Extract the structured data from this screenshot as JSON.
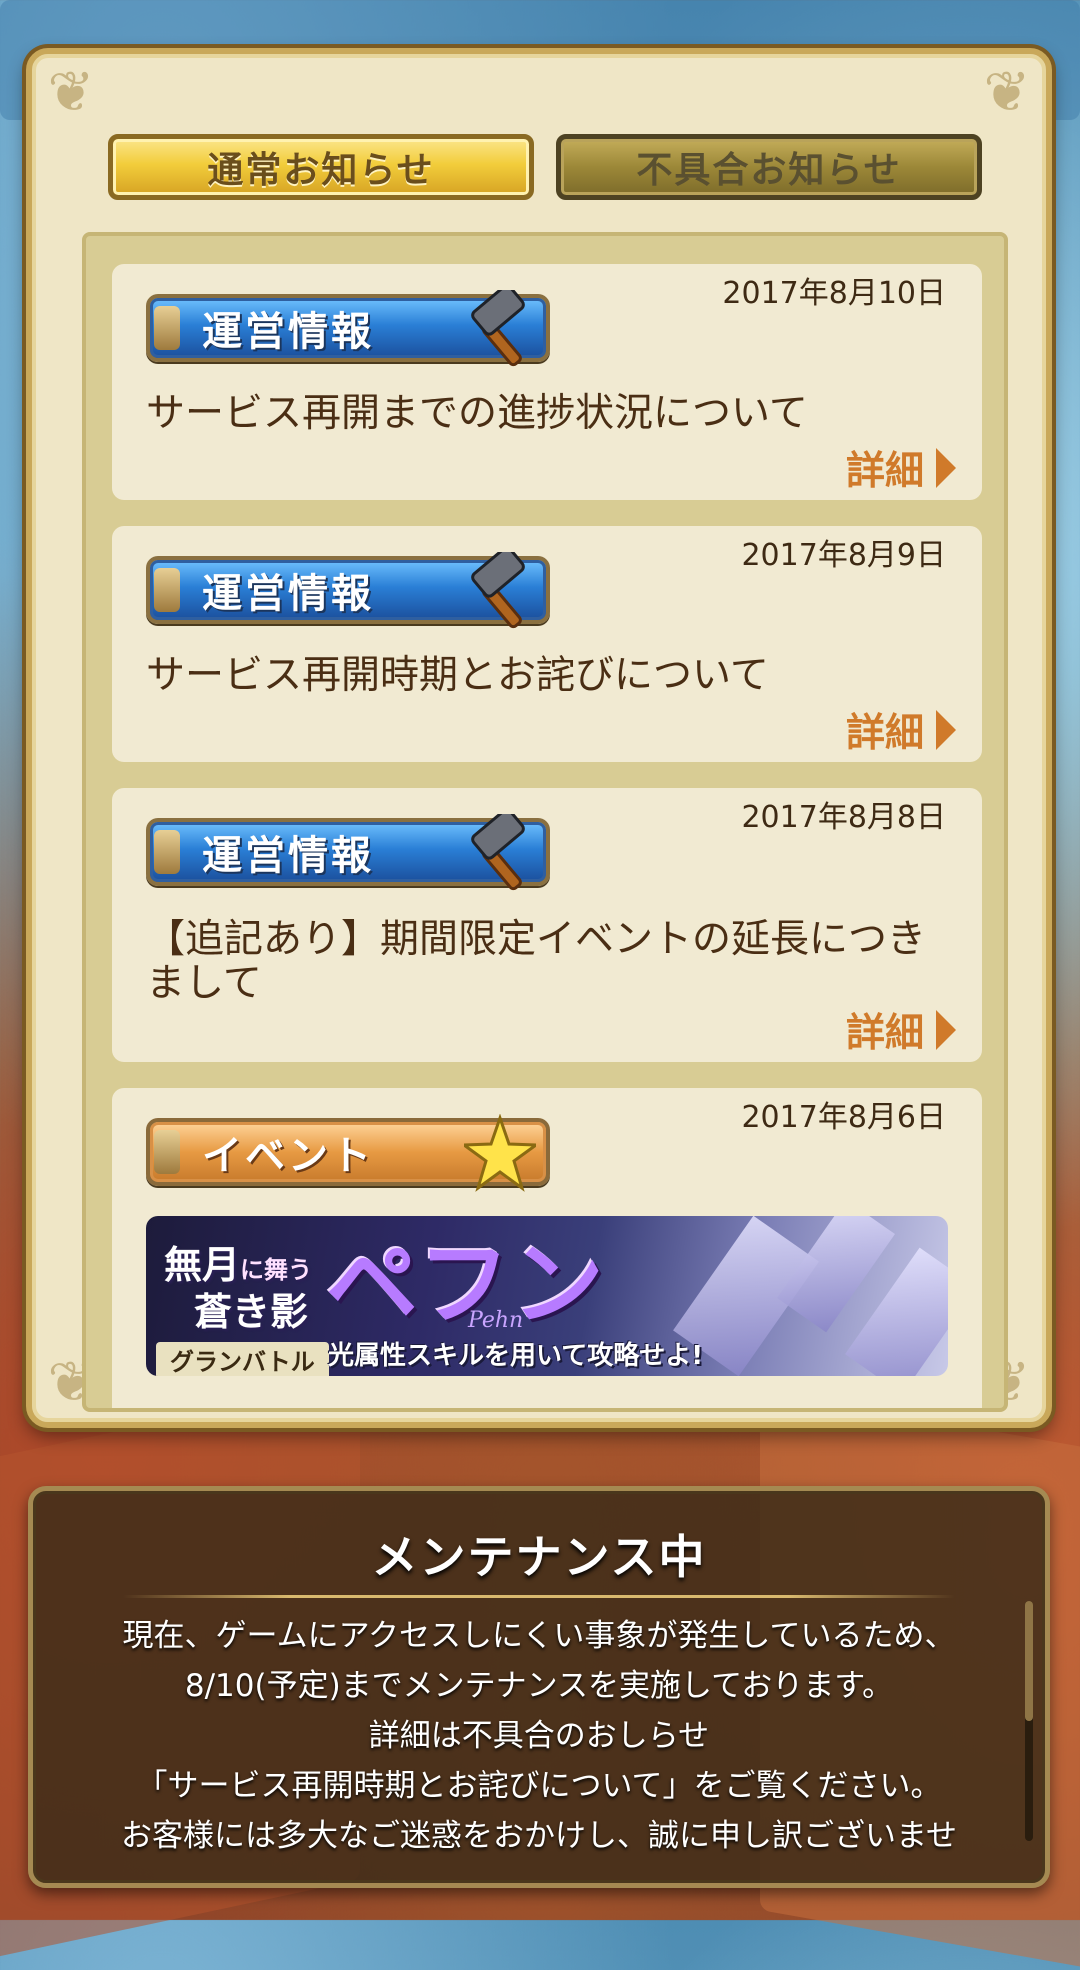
{
  "tabs": {
    "normal": "通常お知らせ",
    "bug": "不具合お知らせ",
    "active": "normal"
  },
  "notices": [
    {
      "date": "2017年8月10日",
      "category": "運営情報",
      "category_icon": "hammer-icon",
      "title": "サービス再開までの進捗状況について",
      "detail_label": "詳細"
    },
    {
      "date": "2017年8月9日",
      "category": "運営情報",
      "category_icon": "hammer-icon",
      "title": "サービス再開時期とお詫びについて",
      "detail_label": "詳細"
    },
    {
      "date": "2017年8月8日",
      "category": "運営情報",
      "category_icon": "hammer-icon",
      "title": "【追記あり】期間限定イベントの延長につきまして",
      "detail_label": "詳細"
    },
    {
      "date": "2017年8月6日",
      "category": "イベント",
      "category_icon": "star-icon",
      "banner": {
        "title_line1": "無月",
        "title_small1": "に",
        "title_line1b": "舞う",
        "title_line2": "蒼き影",
        "name": "ペフン",
        "name_sub": "Pehn",
        "tag": "グランバトル",
        "caption": "光属性スキルを用いて攻略せよ!"
      }
    }
  ],
  "maintenance": {
    "title": "メンテナンス中",
    "lines": [
      "現在、ゲームにアクセスしにくい事象が発生しているため、",
      "8/10(予定)までメンテナンスを実施しております。",
      "詳細は不具合のおしらせ",
      "「サービス再開時期とお詫びについて」をご覧ください。",
      "お客様には多大なご迷惑をおかけし、誠に申し訳ございませ"
    ]
  },
  "colors": {
    "panel_bg": "#efe6c6",
    "card_bg": "#f1ead2",
    "text_brown": "#4a2e14",
    "detail_orange": "#d07a2a",
    "ops_blue": "#2a7fd6",
    "event_orange": "#e79a43",
    "tab_gold": "#f2cd3b"
  }
}
